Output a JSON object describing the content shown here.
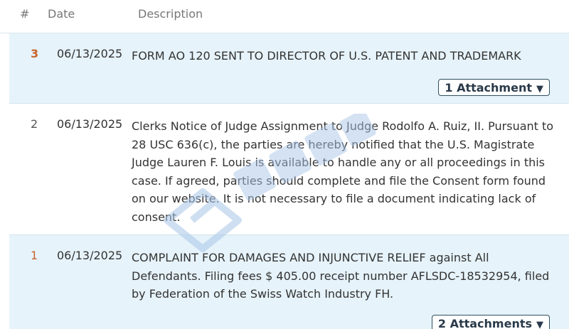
{
  "header": {
    "num": "#",
    "date": "Date",
    "description": "Description"
  },
  "entries": [
    {
      "number": "3",
      "date": "06/13/2025",
      "description": "FORM AO 120 SENT TO DIRECTOR OF U.S. PATENT AND TRADEMARK",
      "attachments_label": "1 Attachment",
      "caret": "▼"
    },
    {
      "number": "2",
      "date": "06/13/2025",
      "description": "Clerks Notice of Judge Assignment to Judge Rodolfo A. Ruiz, II. Pursuant to 28 USC 636(c), the parties are hereby notified that the U.S. Magistrate Judge Lauren F. Louis is available to handle any or all proceedings in this case. If agreed, parties should complete and file the Consent form found on our website. It is not necessary to file a document indicating lack of consent."
    },
    {
      "number": "1",
      "date": "06/13/2025",
      "description": "COMPLAINT FOR DAMAGES AND INJUNCTIVE RELIEF against All Defendants. Filing fees $ 405.00 receipt number AFLSDC-18532954, filed by Federation of the Swiss Watch Industry FH.",
      "attachments_label": "2 Attachments",
      "caret": "▼"
    }
  ],
  "colors": {
    "row_shade": "#e6f3fa",
    "entry_number_accent": "#c8642c",
    "button_border": "#2f4f5f",
    "watermark": "#a9c6e8"
  }
}
